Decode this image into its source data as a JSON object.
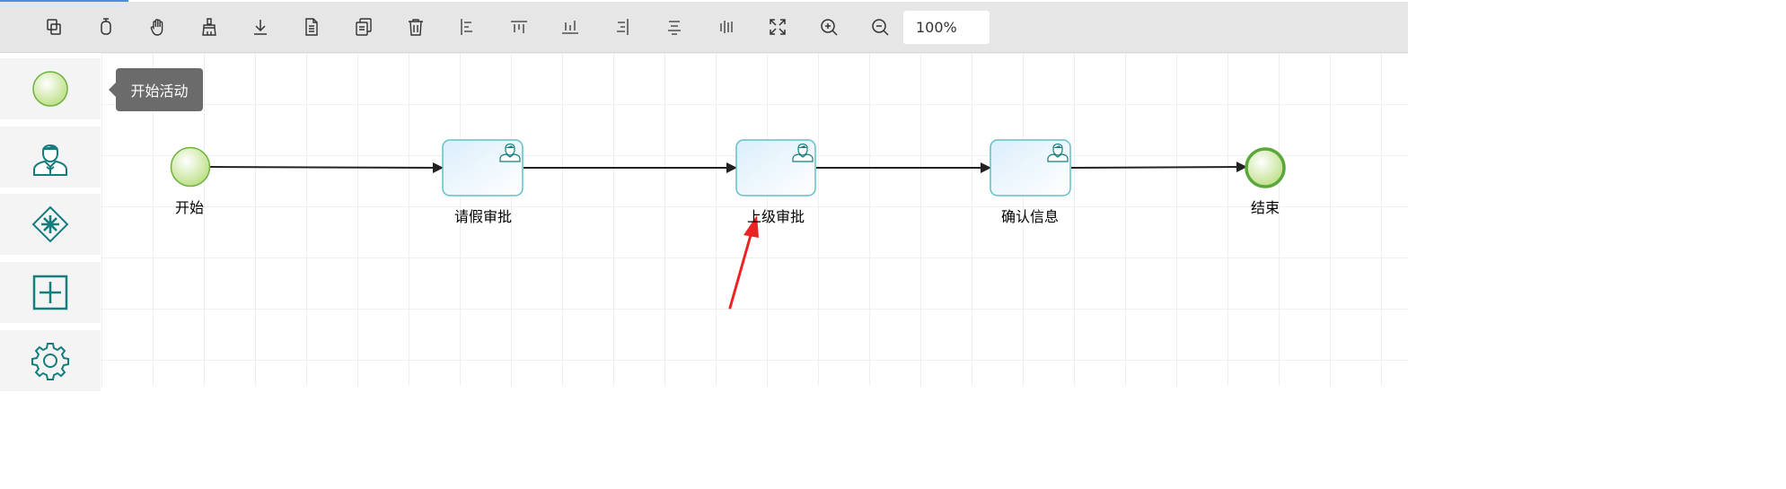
{
  "toolbar": {
    "tools": [
      {
        "name": "copy-icon"
      },
      {
        "name": "cut-icon"
      },
      {
        "name": "hand-icon"
      },
      {
        "name": "brush-icon"
      },
      {
        "name": "download-icon"
      },
      {
        "name": "document-icon"
      },
      {
        "name": "duplicate-icon"
      },
      {
        "name": "delete-icon"
      },
      {
        "name": "align-left-icon"
      },
      {
        "name": "align-top-icon"
      },
      {
        "name": "align-bottom-icon"
      },
      {
        "name": "align-right-icon"
      },
      {
        "name": "align-center-horizontal-icon"
      },
      {
        "name": "align-center-vertical-icon"
      },
      {
        "name": "fullscreen-icon"
      },
      {
        "name": "zoom-in-icon"
      },
      {
        "name": "zoom-out-icon"
      }
    ],
    "zoom_level": "100%"
  },
  "palette": {
    "items": [
      {
        "name": "start-event-icon"
      },
      {
        "name": "user-task-icon"
      },
      {
        "name": "gateway-icon"
      },
      {
        "name": "subprocess-icon"
      },
      {
        "name": "service-task-icon"
      }
    ],
    "tooltip": "开始活动"
  },
  "diagram": {
    "start_label": "开始",
    "task1_label": "请假审批",
    "task2_label": "上级审批",
    "task3_label": "确认信息",
    "end_label": "结束"
  },
  "colors": {
    "teal": "#147d7d",
    "event_green": "#6db33f",
    "arrow_red": "#ee2222"
  }
}
